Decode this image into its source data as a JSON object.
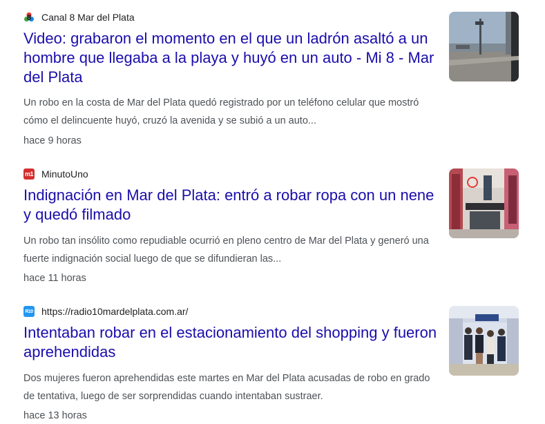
{
  "results": [
    {
      "source_name": "Canal 8 Mar del Plata",
      "favicon": "canal8-logo-icon",
      "title": "Video: grabaron el momento en el que un ladrón asaltó a un hombre que llegaba a la playa y huyó en un auto - Mi 8 - Mar del Plata",
      "snippet": "Un robo en la costa de Mar del Plata quedó registrado por un teléfono celular que mostró cómo el delincuente huyó, cruzó la avenida y se subió a un auto...",
      "time": "hace 9 horas"
    },
    {
      "source_name": "MinutoUno",
      "favicon": "minutouno-logo-icon",
      "favicon_text": "m1",
      "title": "Indignación en Mar del Plata: entró a robar ropa con un nene y quedó filmado",
      "snippet": "Un robo tan insólito como repudiable ocurrió en pleno centro de Mar del Plata y generó una fuerte indignación social luego de que se difundieran las...",
      "time": "hace 11 horas"
    },
    {
      "source_name": "https://radio10mardelplata.com.ar/",
      "favicon": "radio10-logo-icon",
      "favicon_text": "R10",
      "title": "Intentaban robar en el estacionamiento del shopping y fueron aprehendidas",
      "snippet": "Dos mujeres fueron aprehendidas este martes en Mar del Plata acusadas de robo en grado de tentativa, luego de ser sorprendidas cuando intentaban sustraer.",
      "time": "hace 13 horas"
    }
  ],
  "colors": {
    "title_link": "#1a0dab",
    "snippet": "#4d5156",
    "source": "#202124",
    "minutouno_red": "#d32f2f",
    "radio10_blue": "#2196f3"
  }
}
